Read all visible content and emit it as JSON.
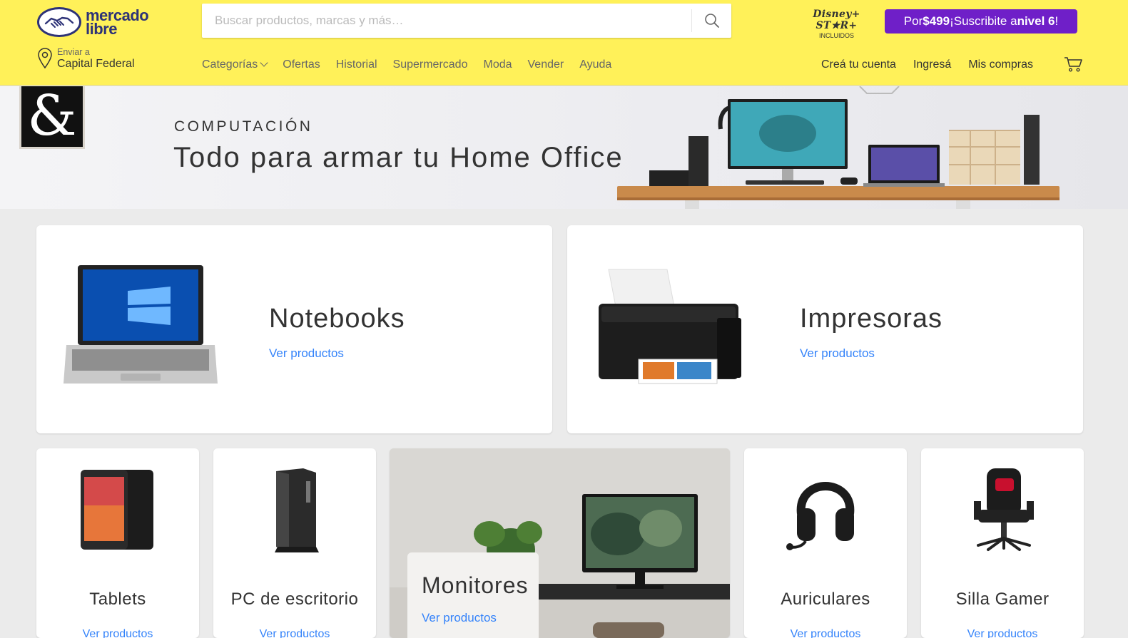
{
  "header": {
    "logo_line1": "mercado",
    "logo_line2": "libre",
    "search_placeholder": "Buscar productos, marcas y más…",
    "disney_text": "Disney+ ST★R+",
    "disney_sub": "INCLUIDOS",
    "promo_prefix": "Por ",
    "promo_price": "$499",
    "promo_middle": " ¡Suscribite a ",
    "promo_level": "nivel 6",
    "promo_suffix": "!",
    "location_label": "Enviar a",
    "location_value": "Capital Federal",
    "nav": [
      "Categorías",
      "Ofertas",
      "Historial",
      "Supermercado",
      "Moda",
      "Vender",
      "Ayuda"
    ],
    "account": [
      "Creá tu cuenta",
      "Ingresá",
      "Mis compras"
    ]
  },
  "banner": {
    "kicker": "COMPUTACIÓN",
    "title": "Todo para armar tu Home Office",
    "logo_glyph": "&"
  },
  "featured": [
    {
      "title": "Notebooks",
      "link": "Ver productos"
    },
    {
      "title": "Impresoras",
      "link": "Ver productos"
    }
  ],
  "categories": [
    {
      "title": "Tablets",
      "link": "Ver productos"
    },
    {
      "title": "PC de escritorio",
      "link": "Ver productos"
    },
    {
      "title": "Monitores",
      "link": "Ver productos"
    },
    {
      "title": "Auriculares",
      "link": "Ver productos"
    },
    {
      "title": "Silla Gamer",
      "link": "Ver productos"
    }
  ],
  "colors": {
    "header_bg": "#fff159",
    "brand_navy": "#2d3277",
    "promo_purple": "#6f1fc8",
    "link_blue": "#3483fa",
    "page_bg": "#ebebeb"
  }
}
